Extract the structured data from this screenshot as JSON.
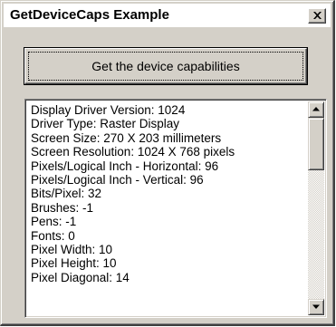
{
  "window": {
    "title": "GetDeviceCaps Example",
    "close_icon": "close-x-icon"
  },
  "action": {
    "button_label": "Get the device capabilities"
  },
  "listbox": {
    "items": [
      "Display Driver Version: 1024",
      "Driver Type: Raster Display",
      "Screen Size: 270 X 203 millimeters",
      "Screen Resolution: 1024 X 768 pixels",
      "Pixels/Logical Inch - Horizontal: 96",
      "Pixels/Logical Inch - Vertical: 96",
      "Bits/Pixel: 32",
      "Brushes: -1",
      "Pens: -1",
      "Fonts: 0",
      "Pixel Width: 10",
      "Pixel Height: 10",
      "Pixel Diagonal: 14"
    ],
    "scrollbar": {
      "up_icon": "triangle-up-icon",
      "down_icon": "triangle-down-icon"
    }
  }
}
